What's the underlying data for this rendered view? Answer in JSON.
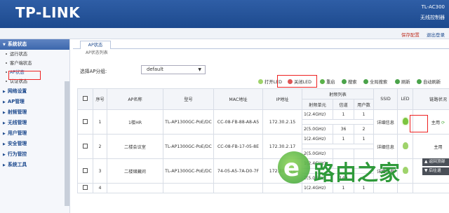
{
  "header": {
    "brand": "TP-LINK",
    "model": "TL-AC300",
    "subtitle": "无线控制器"
  },
  "topbar": {
    "save": "保存配置",
    "logout": "退出登录"
  },
  "sidebar": {
    "groups": [
      {
        "label": "系统状态",
        "items": [
          "运行状态",
          "客户端状态",
          "AP状态",
          "认证状态"
        ]
      },
      {
        "label": "网络设置"
      },
      {
        "label": "AP管理"
      },
      {
        "label": "射频管理"
      },
      {
        "label": "无线管理"
      },
      {
        "label": "用户管理"
      },
      {
        "label": "安全管理"
      },
      {
        "label": "行为管控"
      },
      {
        "label": "系统工具"
      }
    ]
  },
  "content": {
    "tab": "AP状态",
    "breadcrumb": "AP状态列表",
    "group_label": "选择AP分组:",
    "group_value": "default",
    "toolbar": [
      "打开LED",
      "关闭LED",
      "重启",
      "搜索",
      "全局搜索",
      "刷新",
      "自动刷新"
    ],
    "table": {
      "headers": [
        "序号",
        "AP名称",
        "型号",
        "MAC地址",
        "IP地址",
        "射频列表",
        "SSID",
        "LED",
        "链路状况"
      ],
      "subheaders": [
        "射频单元",
        "信道",
        "用户数"
      ],
      "rows": [
        {
          "index": "1",
          "name": "1楼HR",
          "model": "TL-AP1300GC-PoE/DC",
          "mac": "CC-08-FB-88-A8-A5",
          "ip": "172.30.2.15",
          "radios": [
            {
              "unit": "1(2.4GHz)",
              "channel": "1",
              "users": "1"
            },
            {
              "unit": "2(5.0GHz)",
              "channel": "36",
              "users": "2"
            }
          ],
          "ssid": "详细信息",
          "link": "主用"
        },
        {
          "index": "2",
          "name": "二楼会议室",
          "model": "TL-AP1300GC-PoE/DC",
          "mac": "CC-08-FB-17-05-8E",
          "ip": "172.30.2.17",
          "radios": [
            {
              "unit": "1(2.4GHz)",
              "channel": "1",
              "users": "1"
            },
            {
              "unit": "2(5.0GHz)",
              "channel": "",
              "users": ""
            }
          ],
          "ssid": "详细信息",
          "link": "主用"
        },
        {
          "index": "3",
          "name": "二楼储藏间",
          "model": "TL-AP1300GC-PoE/DC",
          "mac": "74-05-A5-7A-D0-7F",
          "ip": "172.30.2.18",
          "radios": [
            {
              "unit": "1(2.4GHz)",
              "channel": "",
              "users": ""
            },
            {
              "unit": "2(5.0GHz)",
              "channel": "149",
              "users": "3"
            }
          ],
          "ssid": "详细信息",
          "link": "主用"
        },
        {
          "index": "4",
          "name": "",
          "model": "",
          "mac": "",
          "ip": "",
          "radios": [
            {
              "unit": "1(2.4GHz)",
              "channel": "1",
              "users": "1"
            }
          ],
          "ssid": "",
          "link": ""
        }
      ]
    }
  },
  "floating": {
    "back_top": "返回顶部",
    "back_prev": "后往退"
  },
  "watermark": {
    "text": "路由之家"
  },
  "colors": {
    "header": "#1d4a8e",
    "highlight": "#e22222",
    "led_on": "#7cc540"
  }
}
